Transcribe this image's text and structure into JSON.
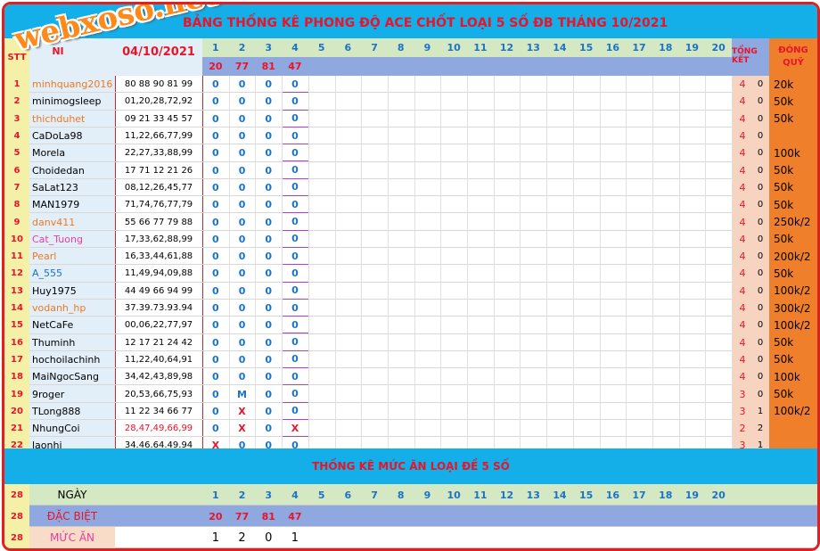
{
  "title": "BẢNG THỐNG KÊ PHONG ĐỘ ACE CHỐT LOẠI 5 SỐ ĐB THÁNG 10/2021",
  "logo_text": "webxoso.net",
  "header": {
    "stt_label": "STT",
    "name_label": "NI",
    "date": "04/10/2021",
    "total_label": "TỔNG KẾT",
    "fund_label": "ĐÓNG QUỸ",
    "days": [
      "1",
      "2",
      "3",
      "4",
      "5",
      "6",
      "7",
      "8",
      "9",
      "10",
      "11",
      "12",
      "13",
      "14",
      "15",
      "16",
      "17",
      "18",
      "19",
      "20"
    ],
    "results": [
      "20",
      "77",
      "81",
      "47"
    ]
  },
  "rows": [
    {
      "stt": "1",
      "name": "minhquang2016",
      "name_color": "orange",
      "nums": "80 88 90 81 99",
      "nums_color": "black",
      "marks": [
        "0",
        "0",
        "0",
        "0"
      ],
      "t1": "4",
      "t2": "0",
      "fund": "20k"
    },
    {
      "stt": "2",
      "name": "minimogsleep",
      "name_color": "black",
      "nums": "01,20,28,72,92",
      "nums_color": "black",
      "marks": [
        "0",
        "0",
        "0",
        "0"
      ],
      "t1": "4",
      "t2": "0",
      "fund": "50k"
    },
    {
      "stt": "3",
      "name": "thichduhet",
      "name_color": "orange",
      "nums": "09 21 33 45 57",
      "nums_color": "black",
      "marks": [
        "0",
        "0",
        "0",
        "0"
      ],
      "t1": "4",
      "t2": "0",
      "fund": "50k"
    },
    {
      "stt": "4",
      "name": "CaDoLa98",
      "name_color": "black",
      "nums": "11,22,66,77,99",
      "nums_color": "black",
      "marks": [
        "0",
        "0",
        "0",
        "0"
      ],
      "t1": "4",
      "t2": "0",
      "fund": ""
    },
    {
      "stt": "5",
      "name": "Morela",
      "name_color": "black",
      "nums": "22,27,33,88,99",
      "nums_color": "black",
      "marks": [
        "0",
        "0",
        "0",
        "0"
      ],
      "t1": "4",
      "t2": "0",
      "fund": "100k"
    },
    {
      "stt": "6",
      "name": "Choidedan",
      "name_color": "black",
      "nums": "17 71 12 21 26",
      "nums_color": "black",
      "marks": [
        "0",
        "0",
        "0",
        "0"
      ],
      "t1": "4",
      "t2": "0",
      "fund": "50k"
    },
    {
      "stt": "7",
      "name": "SaLat123",
      "name_color": "black",
      "nums": "08,12,26,45,77",
      "nums_color": "black",
      "marks": [
        "0",
        "0",
        "0",
        "0"
      ],
      "t1": "4",
      "t2": "0",
      "fund": "50k"
    },
    {
      "stt": "8",
      "name": "MAN1979",
      "name_color": "black",
      "nums": "71,74,76,77,79",
      "nums_color": "black",
      "marks": [
        "0",
        "0",
        "0",
        "0"
      ],
      "t1": "4",
      "t2": "0",
      "fund": "50k"
    },
    {
      "stt": "9",
      "name": "danv411",
      "name_color": "orange",
      "nums": "55 66 77 79 88",
      "nums_color": "black",
      "marks": [
        "0",
        "0",
        "0",
        "0"
      ],
      "t1": "4",
      "t2": "0",
      "fund": "250k/2"
    },
    {
      "stt": "10",
      "name": "Cat_Tuong",
      "name_color": "pink",
      "nums": "17,33,62,88,99",
      "nums_color": "black",
      "marks": [
        "0",
        "0",
        "0",
        "0"
      ],
      "t1": "4",
      "t2": "0",
      "fund": "50k"
    },
    {
      "stt": "11",
      "name": "Pearl",
      "name_color": "orange",
      "nums": "16,33,44,61,88",
      "nums_color": "black",
      "marks": [
        "0",
        "0",
        "0",
        "0"
      ],
      "t1": "4",
      "t2": "0",
      "fund": "200k/2"
    },
    {
      "stt": "12",
      "name": "A_555",
      "name_color": "blue",
      "nums": "11,49,94,09,88",
      "nums_color": "black",
      "marks": [
        "0",
        "0",
        "0",
        "0"
      ],
      "t1": "4",
      "t2": "0",
      "fund": "50k"
    },
    {
      "stt": "13",
      "name": "Huy1975",
      "name_color": "black",
      "nums": "44 49 66 94 99",
      "nums_color": "black",
      "marks": [
        "0",
        "0",
        "0",
        "0"
      ],
      "t1": "4",
      "t2": "0",
      "fund": "100k/2"
    },
    {
      "stt": "14",
      "name": "vodanh_hp",
      "name_color": "orange",
      "nums": "37.39.73.93.94",
      "nums_color": "black",
      "marks": [
        "0",
        "0",
        "0",
        "0"
      ],
      "t1": "4",
      "t2": "0",
      "fund": "300k/2"
    },
    {
      "stt": "15",
      "name": "NetCaFe",
      "name_color": "black",
      "nums": "00,06,22,77,97",
      "nums_color": "black",
      "marks": [
        "0",
        "0",
        "0",
        "0"
      ],
      "t1": "4",
      "t2": "0",
      "fund": "100k/2"
    },
    {
      "stt": "16",
      "name": "Thuminh",
      "name_color": "black",
      "nums": "12 17 21 24 42",
      "nums_color": "black",
      "marks": [
        "0",
        "0",
        "0",
        "0"
      ],
      "t1": "4",
      "t2": "0",
      "fund": "50k"
    },
    {
      "stt": "17",
      "name": "hochoilachinh",
      "name_color": "black",
      "nums": "11,22,40,64,91",
      "nums_color": "black",
      "marks": [
        "0",
        "0",
        "0",
        "0"
      ],
      "t1": "4",
      "t2": "0",
      "fund": "50k"
    },
    {
      "stt": "18",
      "name": "MaiNgocSang",
      "name_color": "black",
      "nums": "34,42,43,89,98",
      "nums_color": "black",
      "marks": [
        "0",
        "0",
        "0",
        "0"
      ],
      "t1": "4",
      "t2": "0",
      "fund": "100k"
    },
    {
      "stt": "19",
      "name": "9roger",
      "name_color": "black",
      "nums": "20,53,66,75,93",
      "nums_color": "black",
      "marks": [
        "0",
        "M",
        "0",
        "0"
      ],
      "t1": "3",
      "t2": "0",
      "fund": "50k"
    },
    {
      "stt": "20",
      "name": "TLong888",
      "name_color": "black",
      "nums": "11 22 34 66 77",
      "nums_color": "black",
      "marks": [
        "0",
        "X",
        "0",
        "0"
      ],
      "t1": "3",
      "t2": "1",
      "fund": "100k/2"
    },
    {
      "stt": "21",
      "name": "NhungCoi",
      "name_color": "black",
      "nums": "28,47,49,66,99",
      "nums_color": "red",
      "marks": [
        "0",
        "X",
        "0",
        "X"
      ],
      "t1": "2",
      "t2": "2",
      "fund": ""
    },
    {
      "stt": "22",
      "name": "laonhi",
      "name_color": "black",
      "nums": "34.46.64.49.94",
      "nums_color": "black",
      "marks": [
        "X",
        "0",
        "0",
        "0"
      ],
      "t1": "3",
      "t2": "1",
      "fund": ""
    }
  ],
  "summary": {
    "title": "THỐNG KÊ MỨC ĂN LOẠI ĐỀ 5 SỐ",
    "rows": [
      {
        "stt": "28",
        "label": "NGÀY",
        "values": [
          "1",
          "2",
          "3",
          "4",
          "5",
          "6",
          "7",
          "8",
          "9",
          "10",
          "11",
          "12",
          "13",
          "14",
          "15",
          "16",
          "17",
          "18",
          "19",
          "20"
        ]
      },
      {
        "stt": "28",
        "label": "ĐẶC BIỆT",
        "values": [
          "20",
          "77",
          "81",
          "47"
        ]
      },
      {
        "stt": "28",
        "label": "MỨC ĂN",
        "values": [
          "1",
          "2",
          "0",
          "1"
        ]
      }
    ]
  },
  "colors": {
    "title_bg": "#14aee8",
    "header_green": "#d4e8c4",
    "header_purple": "#8fa8e0",
    "fund_orange": "#f07f2c",
    "total_peach": "#f7d4c0",
    "name_col_bg": "#e2eef8",
    "stt_bg": "#f5f0a8",
    "red": "#e8142a",
    "blue": "#1a73c9"
  }
}
